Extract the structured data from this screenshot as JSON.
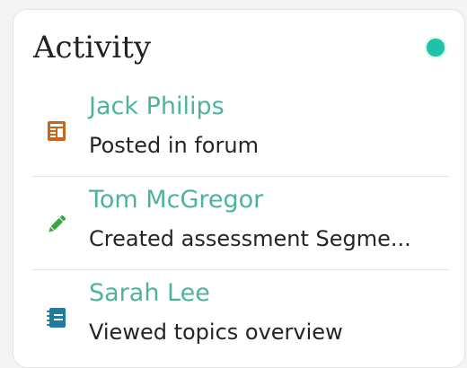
{
  "card": {
    "title": "Activity",
    "status_color": "#1ec2a6"
  },
  "activities": [
    {
      "name": "Jack Philips",
      "action": "Posted in forum",
      "icon": "forum-post-icon",
      "icon_color": "#c9661d"
    },
    {
      "name": "Tom McGregor",
      "action": "Created assessment Segme...",
      "icon": "pencil-icon",
      "icon_color": "#3aa63e"
    },
    {
      "name": "Sarah Lee",
      "action": "Viewed topics overview",
      "icon": "notebook-icon",
      "icon_color": "#1f7d9c"
    }
  ],
  "colors": {
    "name_text": "#4db39f",
    "action_text": "#252525"
  }
}
